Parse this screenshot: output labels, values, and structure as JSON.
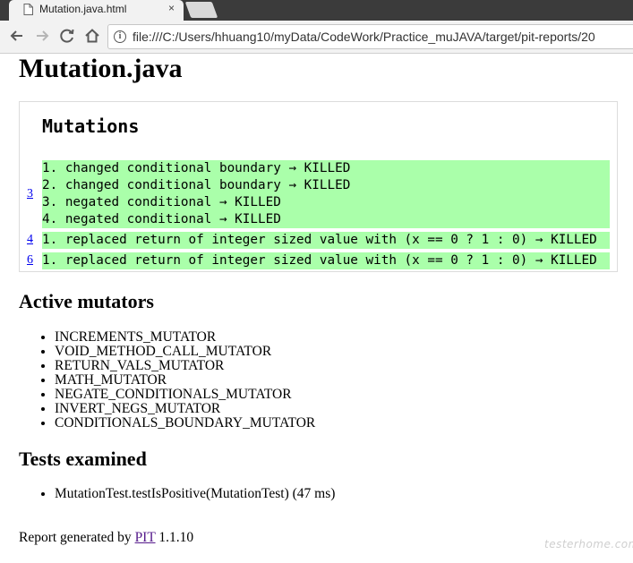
{
  "browser": {
    "tab_title": "Mutation.java.html",
    "tab_close": "×",
    "url": "file:///C:/Users/hhuang10/myData/CodeWork/Practice_muJAVA/target/pit-reports/20"
  },
  "page": {
    "title": "Mutation.java",
    "mutations_heading": "Mutations",
    "mutation_groups": [
      {
        "line": "3",
        "items": [
          "1. changed conditional boundary → KILLED",
          "2. changed conditional boundary → KILLED",
          "3. negated conditional → KILLED",
          "4. negated conditional → KILLED"
        ]
      },
      {
        "line": "4",
        "items": [
          "1. replaced return of integer sized value with (x == 0 ? 1 : 0) → KILLED"
        ]
      },
      {
        "line": "6",
        "items": [
          "1. replaced return of integer sized value with (x == 0 ? 1 : 0) → KILLED"
        ]
      }
    ],
    "killed_color": "#aaffaa",
    "active_mutators_heading": "Active mutators",
    "active_mutators": [
      "INCREMENTS_MUTATOR",
      "VOID_METHOD_CALL_MUTATOR",
      "RETURN_VALS_MUTATOR",
      "MATH_MUTATOR",
      "NEGATE_CONDITIONALS_MUTATOR",
      "INVERT_NEGS_MUTATOR",
      "CONDITIONALS_BOUNDARY_MUTATOR"
    ],
    "tests_heading": "Tests examined",
    "tests": [
      "MutationTest.testIsPositive(MutationTest) (47 ms)"
    ],
    "footer_prefix": "Report generated by ",
    "footer_link": "PIT",
    "footer_suffix": " 1.1.10"
  },
  "watermark": "testerhome.com"
}
